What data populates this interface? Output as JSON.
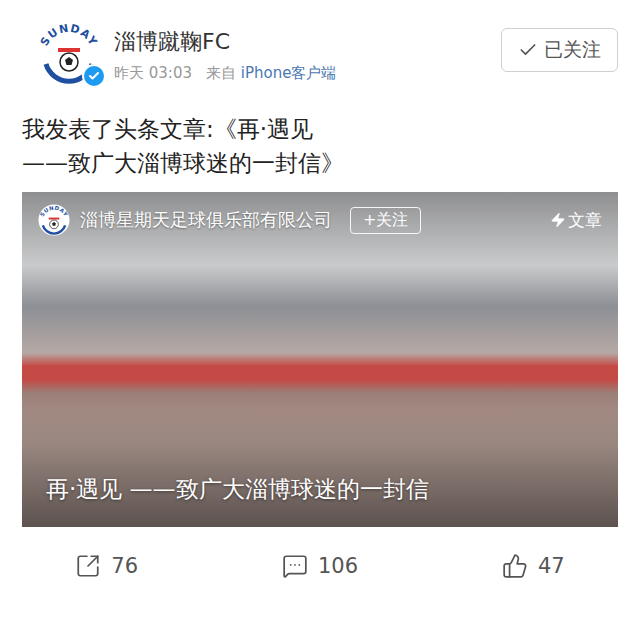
{
  "post": {
    "author": {
      "name": "淄博蹴鞠FC",
      "verified": true,
      "logo_text": "SUNDAY"
    },
    "time": "昨天 03:03",
    "source_prefix": "来自",
    "source": "iPhone客户端",
    "follow": {
      "label": "已关注",
      "following": true
    },
    "text_lines": [
      "我发表了头条文章:《再·遇见",
      "——致广大淄博球迷的一封信》"
    ],
    "card": {
      "publisher": {
        "name": "淄博星期天足球俱乐部有限公司",
        "follow_label": "+关注",
        "logo_text": "SUNDAY"
      },
      "type_label": "文章",
      "title": "再·遇见 ——致广大淄博球迷的一封信"
    },
    "actions": [
      {
        "kind": "share",
        "label": "76"
      },
      {
        "kind": "comment",
        "label": "106"
      },
      {
        "kind": "like",
        "label": "47"
      }
    ]
  }
}
